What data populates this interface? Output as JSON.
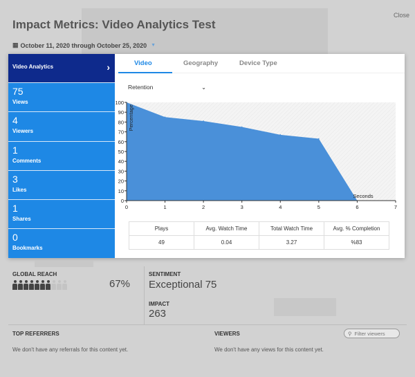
{
  "header": {
    "title": "Impact Metrics: Video Analytics Test",
    "close_label": "Close",
    "date_range": "October 11, 2020 through October 25, 2020"
  },
  "sidebar": {
    "title": "Video Analytics",
    "metrics": [
      {
        "value": "75",
        "label": "Views"
      },
      {
        "value": "4",
        "label": "Viewers"
      },
      {
        "value": "1",
        "label": "Comments"
      },
      {
        "value": "3",
        "label": "Likes"
      },
      {
        "value": "1",
        "label": "Shares"
      },
      {
        "value": "0",
        "label": "Bookmarks"
      }
    ]
  },
  "tabs": [
    {
      "label": "Video",
      "active": true
    },
    {
      "label": "Geography",
      "active": false
    },
    {
      "label": "Device Type",
      "active": false
    }
  ],
  "select": {
    "value": "Retention"
  },
  "chart_data": {
    "type": "area",
    "ylabel": "Percentage",
    "xlabel": "Seconds",
    "x": [
      0,
      1,
      2,
      3,
      4,
      5,
      6
    ],
    "y": [
      100,
      85,
      81,
      75,
      67,
      63,
      0
    ],
    "xlim": [
      0,
      7
    ],
    "ylim": [
      0,
      100
    ],
    "x_ticks": [
      "0",
      "1",
      "2",
      "3",
      "4",
      "5",
      "6",
      "7"
    ],
    "y_ticks": [
      "0",
      "10",
      "20",
      "30",
      "40",
      "50",
      "60",
      "70",
      "80",
      "90",
      "100"
    ],
    "fill_color": "#4a90d9"
  },
  "stats": {
    "headers": [
      "Plays",
      "Avg. Watch Time",
      "Total Watch Time",
      "Avg. % Completion"
    ],
    "values": [
      "49",
      "0.04",
      "3.27",
      "%83"
    ]
  },
  "lower": {
    "global_reach_label": "GLOBAL REACH",
    "global_reach_value": "67%",
    "sentiment_label": "SENTIMENT",
    "sentiment_value": "Exceptional 75",
    "impact_label": "IMPACT",
    "impact_value": "263",
    "top_referrers_label": "TOP REFERRERS",
    "top_referrers_msg": "We don't have any referrals for this content yet.",
    "viewers_label": "VIEWERS",
    "viewers_msg": "We don't have any views for this content yet.",
    "filter_placeholder": "Filter viewers",
    "reach_people_filled": 7,
    "reach_people_total": 10
  }
}
